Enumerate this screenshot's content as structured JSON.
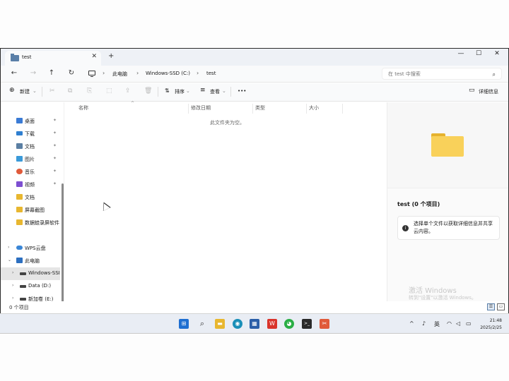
{
  "window": {
    "tab_title": "test",
    "close_glyph": "✕",
    "new_tab_glyph": "+",
    "controls": {
      "minimize": "—",
      "maximize": "☐",
      "close": "✕"
    }
  },
  "address": {
    "back": "←",
    "forward": "→",
    "up": "↑",
    "refresh": "↻",
    "crumbs": [
      "此电脑",
      "Windows-SSD (C:)",
      "test"
    ],
    "sep": "›",
    "search_placeholder": "在 test 中搜索",
    "search_glyph": "⌕"
  },
  "toolbar": {
    "new_label": "新建",
    "new_glyph": "⊕",
    "sort_label": "排序",
    "sort_glyph": "⇅",
    "view_label": "查看",
    "view_glyph": "≡",
    "more_glyph": "•••",
    "details_label": "详细信息",
    "details_glyph": "▭",
    "dropdown_glyph": "⌄",
    "disabled_icons": [
      "✂",
      "⧉",
      "⎘",
      "⬚",
      "⇪",
      "🗑"
    ]
  },
  "sidebar": {
    "pin_glyph": "✦",
    "arrow_glyph": "›",
    "expanded_glyph": "⌄",
    "items": [
      {
        "label": "桌面",
        "icon": "desktop-icon",
        "color": "#3a7bd5",
        "pinned": true
      },
      {
        "label": "下载",
        "icon": "download-icon",
        "color": "#2f7fd0",
        "pinned": true
      },
      {
        "label": "文档",
        "icon": "documents-icon",
        "color": "#5b7fa3",
        "pinned": true
      },
      {
        "label": "图片",
        "icon": "pictures-icon",
        "color": "#3a9ad9",
        "pinned": true
      },
      {
        "label": "音乐",
        "icon": "music-icon",
        "color": "#e05a3a",
        "pinned": true
      },
      {
        "label": "视频",
        "icon": "videos-icon",
        "color": "#7d4fd1",
        "pinned": true
      },
      {
        "label": "文档",
        "icon": "folder-icon",
        "color": "#e8b730",
        "pinned": false
      },
      {
        "label": "屏幕截图",
        "icon": "folder-icon",
        "color": "#e8b730",
        "pinned": false
      },
      {
        "label": "数据蛙录屏软件",
        "icon": "folder-icon",
        "color": "#e8b730",
        "pinned": false
      },
      {
        "label": "WPS云盘",
        "icon": "cloud-icon",
        "color": "#3a86d6",
        "pinned": false
      },
      {
        "label": "此电脑",
        "icon": "pc-icon",
        "color": "#2c6fc0",
        "pinned": false
      },
      {
        "label": "Windows-SSD",
        "icon": "drive-icon",
        "color": "#444444",
        "pinned": false
      },
      {
        "label": "Data (D:)",
        "icon": "drive-icon",
        "color": "#444444",
        "pinned": false
      },
      {
        "label": "新加卷 (E:)",
        "icon": "drive-icon",
        "color": "#444444",
        "pinned": false
      }
    ]
  },
  "filelist": {
    "columns": [
      "名称",
      "修改日期",
      "类型",
      "大小"
    ],
    "sort_glyph": "^",
    "empty_text": "此文件夹为空。"
  },
  "details": {
    "title": "test (0 个项目)",
    "info_glyph": "i",
    "info_text": "选择单个文件以获取详细信息并共享云内容。",
    "activate_line1": "激活 Windows",
    "activate_line2": "转到\"设置\"以激活 Windows。"
  },
  "statusbar": {
    "count_text": "0 个项目",
    "view_details_glyph": "☰",
    "view_tiles_glyph": "▭"
  },
  "taskbar": {
    "apps": [
      {
        "name": "start-icon",
        "color": "#1f6fd1",
        "glyph": "⊞"
      },
      {
        "name": "search-icon",
        "color": "#333333",
        "glyph": "⌕"
      },
      {
        "name": "file-explorer-icon",
        "color": "#e8b730",
        "glyph": "▬"
      },
      {
        "name": "edge-icon",
        "color": "#1a8fb8",
        "glyph": "◉"
      },
      {
        "name": "store-icon",
        "color": "#2b5ea8",
        "glyph": "▦"
      },
      {
        "name": "wps-icon",
        "color": "#d9342b",
        "glyph": "W"
      },
      {
        "name": "wechat-icon",
        "color": "#2aae45",
        "glyph": "◕"
      },
      {
        "name": "terminal-icon",
        "color": "#2a2a2a",
        "glyph": ">_"
      },
      {
        "name": "snip-icon",
        "color": "#e05a3a",
        "glyph": "✂"
      }
    ],
    "tray_chevron": "^",
    "tray_mic": "♪",
    "tray_lang": "英",
    "tray_net": "◠",
    "tray_vol": "◁",
    "tray_batt": "▭",
    "time": "21:48",
    "date": "2025/2/25"
  }
}
